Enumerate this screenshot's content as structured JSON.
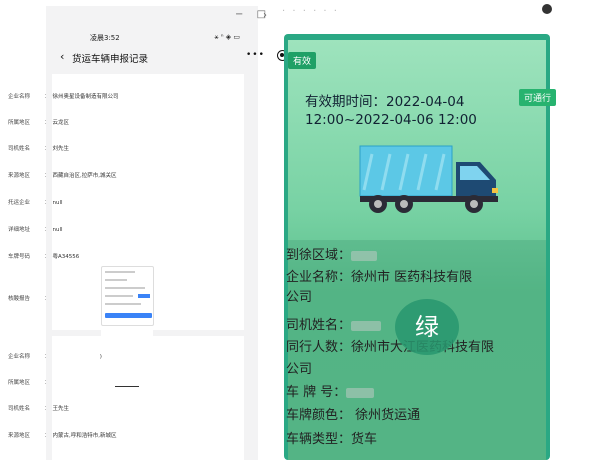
{
  "window": {
    "minimize": "−",
    "maximize": "□",
    "chevron": "›"
  },
  "phone": {
    "time": "凌晨3:52",
    "status_right": "⚹ ⁿ ◈ ▭"
  },
  "nav": {
    "back": "‹",
    "title": "货运车辆申报记录",
    "more": "•••"
  },
  "record1": {
    "rows": [
      {
        "label": "企业名称",
        "value": "徐州奥星设备制造有限公司"
      },
      {
        "label": "所属地区",
        "value": "云龙区"
      },
      {
        "label": "司机姓名",
        "value": "刘先生"
      },
      {
        "label": "来源地区",
        "value": "西藏自治区,拉萨市,城关区"
      },
      {
        "label": "托运企业",
        "value": "null"
      },
      {
        "label": "详细地址",
        "value": "null"
      },
      {
        "label": "车牌号码",
        "value": "粤A34556"
      },
      {
        "label": "核酸报告",
        "value": ""
      }
    ]
  },
  "record2": {
    "rows": [
      {
        "label": "企业名称",
        "value": ")"
      },
      {
        "label": "所属地区",
        "value": ""
      },
      {
        "label": "司机姓名",
        "value": "王先生"
      },
      {
        "label": "来源地区",
        "value": "内蒙古,呼和浩特市,新城区"
      }
    ]
  },
  "pass": {
    "valid_badge": "有效",
    "pass_badge": "可通行",
    "validity_line1": "有效期时间：2022-04-04",
    "validity_line2": "12:00~2022-04-06 12:00",
    "green_label": "绿",
    "fields": [
      {
        "text": "到徐区域："
      },
      {
        "text": "企业名称：徐州市  医药科技有限"
      },
      {
        "text": "公司"
      },
      {
        "text": "司机姓名："
      },
      {
        "text": "同行人数：徐州市大江医药科技有限"
      },
      {
        "text": "公司"
      },
      {
        "text": "车 牌 号："
      },
      {
        "text": "车牌颜色：      徐州货运通"
      },
      {
        "text": "车辆类型：货车"
      }
    ]
  },
  "colors": {
    "card_green": "#2aa884",
    "badge_green": "#1fa066",
    "accent_blue": "#3a83f7"
  }
}
